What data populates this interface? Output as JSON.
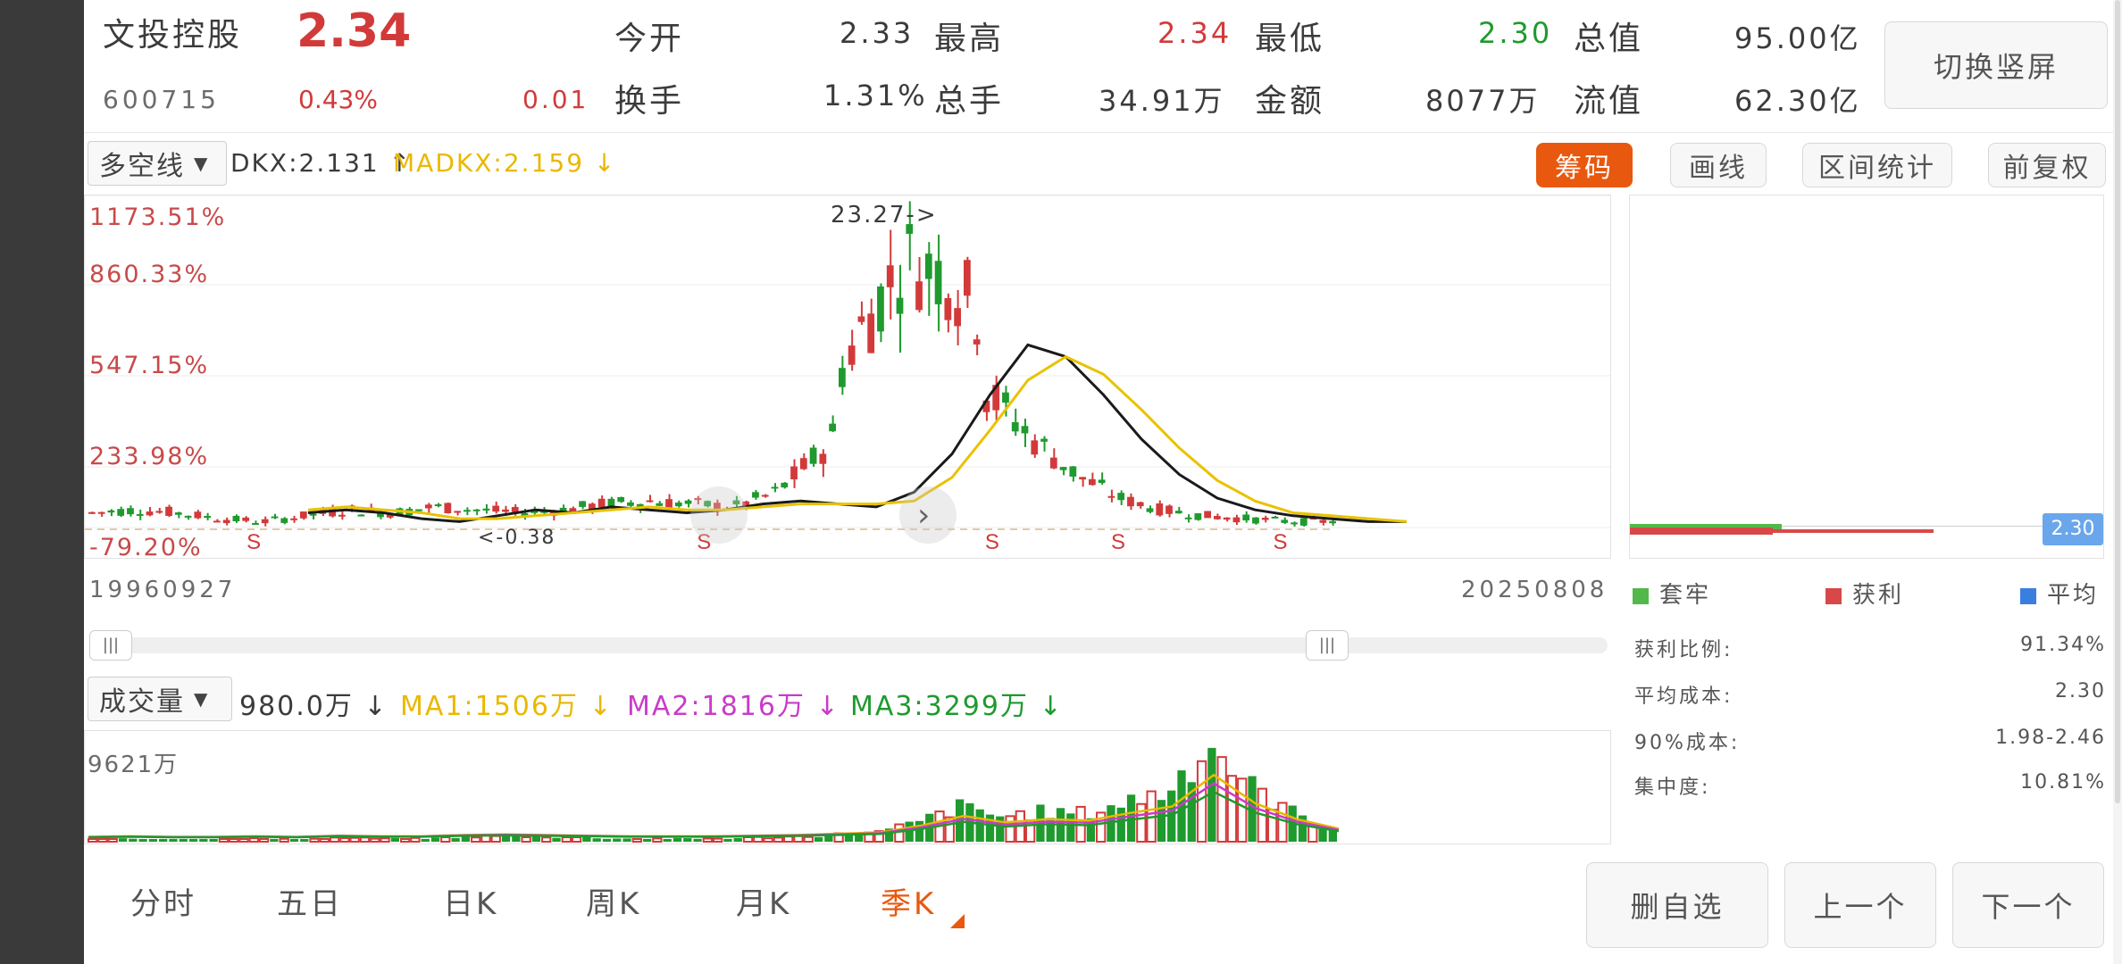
{
  "stock": {
    "name": "文投控股",
    "price": "2.34",
    "code": "600715",
    "change_pct": "0.43%",
    "change_val": "0.01"
  },
  "quote": {
    "open_label": "今开",
    "open_value": "2.33",
    "high_label": "最高",
    "high_value": "2.34",
    "low_label": "最低",
    "low_value": "2.30",
    "mcap_label": "总值",
    "mcap_value": "95.00亿",
    "turnover_label": "换手",
    "turnover_value": "1.31%",
    "volume_label": "总手",
    "volume_value": "34.91万",
    "amount_label": "金额",
    "amount_value": "8077万",
    "float_label": "流值",
    "float_value": "62.30亿"
  },
  "toolbar": {
    "switch_label": "切换竖屏",
    "indicator_select": "多空线",
    "dkx_text": "DKX:2.131 ↑",
    "madkx_text": "MADKX:2.159 ↓",
    "chips_label": "筹码",
    "draw_label": "画线",
    "range_label": "区间统计",
    "adjust_label": "前复权"
  },
  "chart_data": [
    {
      "type": "candlestick",
      "y_tick_labels": [
        "1173.51%",
        "860.33%",
        "547.15%",
        "233.98%",
        "-79.20%"
      ],
      "x_start_label": "19960927",
      "x_end_label": "20250808",
      "annotations": [
        "23.27->",
        "<-0.38"
      ],
      "markers": [
        "S",
        "S",
        "S",
        "S",
        "S"
      ],
      "series": [
        {
          "name": "DKX",
          "color": "#1a1a1a",
          "values": [
            0.05,
            0.06,
            0.05,
            0.03,
            0.02,
            0.04,
            0.06,
            0.05,
            0.07,
            0.06,
            0.05,
            0.06,
            0.08,
            0.09,
            0.08,
            0.07,
            0.12,
            0.25,
            0.45,
            0.62,
            0.58,
            0.45,
            0.3,
            0.18,
            0.1,
            0.06,
            0.04,
            0.03,
            0.02,
            0.02
          ]
        },
        {
          "name": "MADKX",
          "color": "#e9c200",
          "values": [
            0.06,
            0.07,
            0.06,
            0.05,
            0.03,
            0.03,
            0.04,
            0.05,
            0.06,
            0.07,
            0.06,
            0.06,
            0.07,
            0.08,
            0.08,
            0.08,
            0.09,
            0.17,
            0.33,
            0.5,
            0.58,
            0.52,
            0.4,
            0.27,
            0.16,
            0.09,
            0.05,
            0.04,
            0.03,
            0.02
          ]
        }
      ],
      "current_price_tag": "2.30"
    },
    {
      "type": "bar",
      "y_tick_labels": [
        "9621万"
      ],
      "series": [
        {
          "name": "MA1",
          "color": "#e9b800"
        },
        {
          "name": "MA2",
          "color": "#c83cc8"
        },
        {
          "name": "MA3",
          "color": "#1f9a2e"
        }
      ],
      "values": [
        0.02,
        0.03,
        0.02,
        0.02,
        0.03,
        0.02,
        0.04,
        0.03,
        0.03,
        0.05,
        0.06,
        0.05,
        0.04,
        0.03,
        0.03,
        0.03,
        0.04,
        0.05,
        0.07,
        0.09,
        0.2,
        0.35,
        0.25,
        0.3,
        0.28,
        0.4,
        0.5,
        1.0,
        0.55,
        0.3,
        0.15
      ]
    }
  ],
  "volume": {
    "select": "成交量",
    "vol_text": "980.0万 ↓",
    "ma1_text": "MA1:1506万 ↓",
    "ma2_text": "MA2:1816万 ↓",
    "ma3_text": "MA3:3299万 ↓"
  },
  "chips": {
    "legend_trapped": "套牢",
    "legend_profit": "获利",
    "legend_avg": "平均",
    "profit_ratio_label": "获利比例:",
    "profit_ratio_value": "91.34%",
    "avg_cost_label": "平均成本:",
    "avg_cost_value": "2.30",
    "cost90_label": "90%成本:",
    "cost90_value": "1.98-2.46",
    "concentration_label": "集中度:",
    "concentration_value": "10.81%"
  },
  "tabs": [
    "分时",
    "五日",
    "日K",
    "周K",
    "月K",
    "季K"
  ],
  "bottom_buttons": {
    "delete_label": "删自选",
    "prev_label": "上一个",
    "next_label": "下一个"
  },
  "colors": {
    "up": "#d23a3a",
    "down": "#1f9a2e",
    "accent": "#e8580e",
    "ma_yellow": "#e9c200"
  }
}
